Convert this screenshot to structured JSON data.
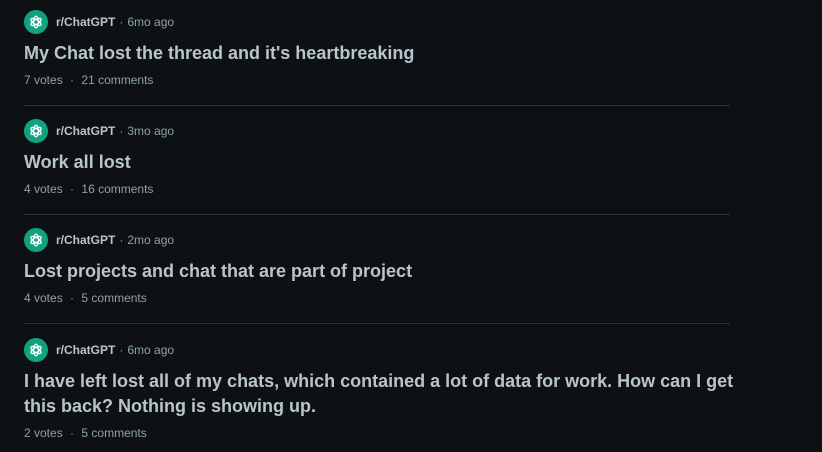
{
  "colors": {
    "background": "#0e1113",
    "title": "#b7c5cd",
    "meta": "#8ba2ad",
    "avatar": "#10a37f",
    "divider": "#2a3236"
  },
  "posts": [
    {
      "avatar_icon": "openai-logo-icon",
      "subreddit": "r/ChatGPT",
      "separator": "·",
      "age": "6mo ago",
      "title": "My Chat lost the thread and it's heartbreaking",
      "votes": "7 votes",
      "comments": "21 comments"
    },
    {
      "avatar_icon": "openai-logo-icon",
      "subreddit": "r/ChatGPT",
      "separator": "·",
      "age": "3mo ago",
      "title": "Work all lost",
      "votes": "4 votes",
      "comments": "16 comments"
    },
    {
      "avatar_icon": "openai-logo-icon",
      "subreddit": "r/ChatGPT",
      "separator": "·",
      "age": "2mo ago",
      "title": "Lost projects and chat that are part of project",
      "votes": "4 votes",
      "comments": "5 comments"
    },
    {
      "avatar_icon": "openai-logo-icon",
      "subreddit": "r/ChatGPT",
      "separator": "·",
      "age": "6mo ago",
      "title": "I have left lost all of my chats, which contained a lot of data for work. How can I get this back? Nothing is showing up.",
      "votes": "2 votes",
      "comments": "5 comments"
    }
  ]
}
